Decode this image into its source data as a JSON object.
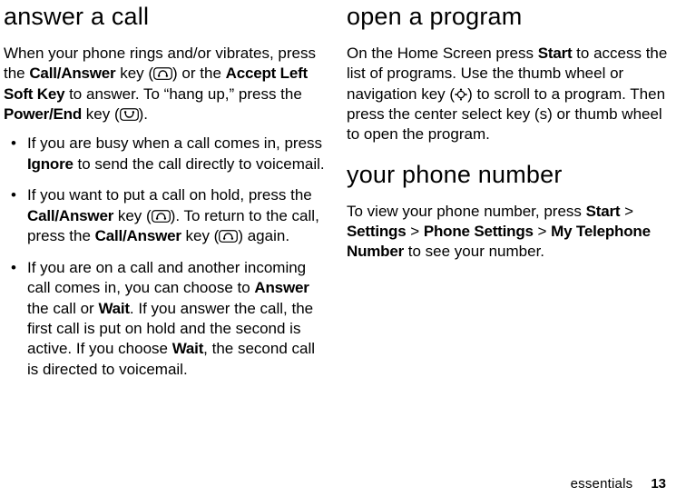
{
  "left": {
    "heading": "answer a call",
    "intro_1": "When your phone rings and/or vibrates, press the ",
    "call_answer": "Call/Answer",
    "intro_2": " key (",
    "intro_3": ") or the ",
    "accept_left": "Accept Left Soft Key",
    "intro_4": " to answer. To “hang up,” press the ",
    "power_end": "Power/End",
    "intro_5": " key (",
    "intro_6": ").",
    "b1_a": "If you are busy when a call comes in, press ",
    "ignore": "Ignore",
    "b1_b": " to send the call directly to voicemail.",
    "b2_a": "If you want to put a call on hold, press the ",
    "b2_b": " key (",
    "b2_c": "). To return to the call, press the ",
    "b2_d": " key (",
    "b2_e": ") again.",
    "b3_a": "If you are on a call and another incoming call comes in, you can choose to ",
    "answer": "Answer",
    "b3_b": " the call or ",
    "wait": "Wait",
    "b3_c": ". If you answer the call, the first call is put on hold and the second is active. If you choose ",
    "b3_d": ", the second call is directed to voicemail."
  },
  "right": {
    "heading1": "open a program",
    "p1_a": "On the Home Screen press ",
    "start": "Start",
    "p1_b": " to access the list of programs. Use the thumb wheel or navigation key (",
    "p1_c": ") to scroll to a program. Then press the center select key (",
    "sel": "s",
    "p1_d": ") or thumb wheel to open the program.",
    "heading2": "your phone number",
    "p2_a": "To view your phone number, press ",
    "gt1": " > ",
    "settings": "Settings",
    "gt2": " > ",
    "phone_settings": "Phone Settings",
    "gt3": " > ",
    "my_tel": "My Telephone Number",
    "p2_b": " to see your number."
  },
  "footer": {
    "section": "essentials",
    "page": "13"
  }
}
